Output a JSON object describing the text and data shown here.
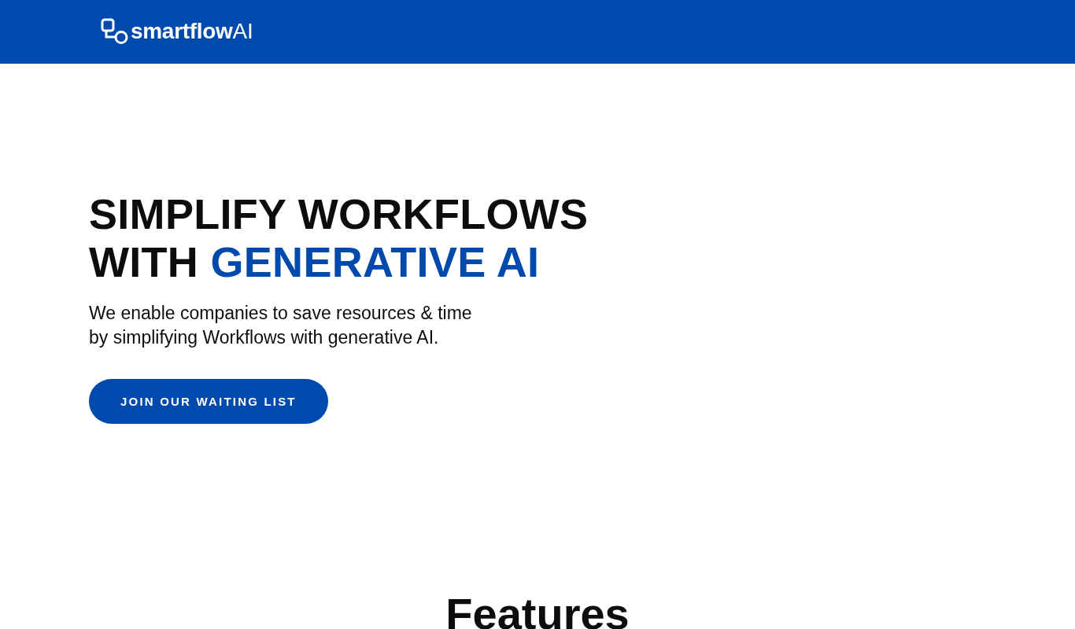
{
  "header": {
    "logo": "**smartflow**AI"
  },
  "hero": {
    "headline": [
      [
        {
          "text": "SIMPLIFY WORKFLOWS",
          "highlight": false
        }
      ],
      [
        {
          "text": "WITH ",
          "highlight": false
        },
        {
          "text": "GENERATIVE AI",
          "highlight": true
        }
      ]
    ],
    "subtitle": [
      "We enable companies to save resources & time",
      "by simplifying Workflows with generative AI."
    ],
    "button": "JOIN OUR WAITING LIST"
  },
  "features": {
    "title": "Features"
  }
}
